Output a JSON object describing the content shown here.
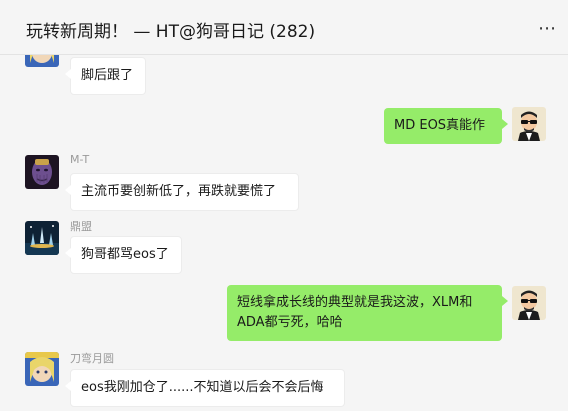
{
  "window": {
    "pin_glyph": "⊼",
    "minimize_glyph": "—",
    "maximize_glyph": "☐",
    "close_glyph": "✕"
  },
  "header": {
    "title": "玩转新周期！ — HT@狗哥日记 (282)",
    "more_glyph": "⋯"
  },
  "messages": [
    {
      "direction": "in",
      "sender": "",
      "text": "脚后跟了",
      "avatar": "anime-avatar"
    },
    {
      "direction": "out",
      "sender": "",
      "text": "MD EOS真能作",
      "avatar": "sunglasses-avatar"
    },
    {
      "direction": "in",
      "sender": "M-T",
      "text": "主流币要创新低了，再跌就要慌了",
      "avatar": "purple-villain-avatar"
    },
    {
      "direction": "in",
      "sender": "鼎盟",
      "text": "狗哥都骂eos了",
      "avatar": "night-fountain-avatar"
    },
    {
      "direction": "out",
      "sender": "",
      "text": "短线拿成长线的典型就是我这波，XLM和\nADA都亏死，哈哈",
      "avatar": "sunglasses-avatar"
    },
    {
      "direction": "in",
      "sender": "刀弯月圆",
      "text": "eos我刚加仓了......不知道以后会不会后悔",
      "avatar": "anime-avatar"
    }
  ]
}
